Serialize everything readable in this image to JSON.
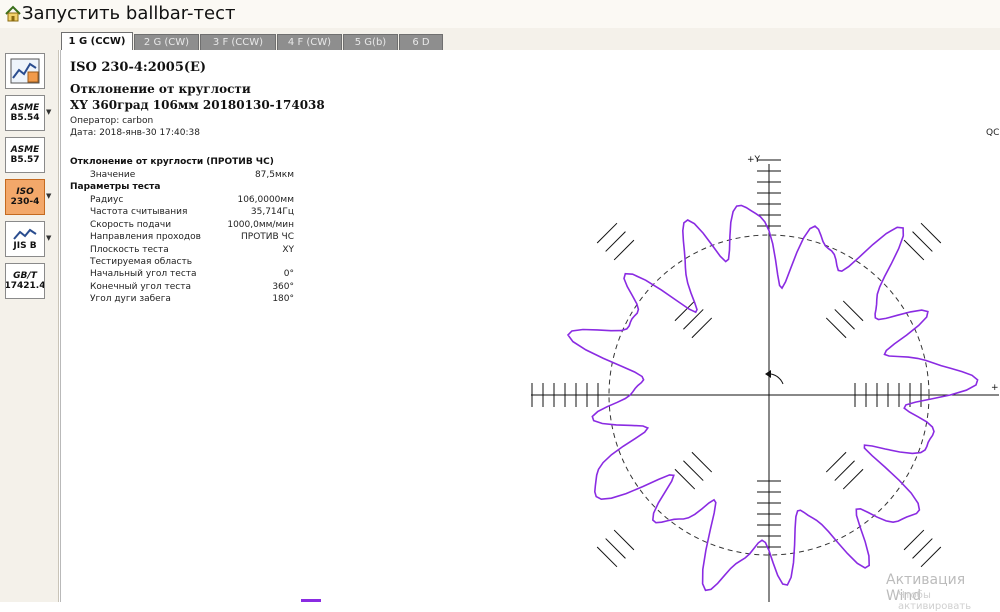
{
  "window": {
    "title": "Запустить ballbar-тест"
  },
  "sidebar": [
    {
      "id": "report",
      "line1": "",
      "line2": ""
    },
    {
      "id": "asme-b554",
      "line1": "ASME",
      "line2": "B5.54"
    },
    {
      "id": "asme-b557",
      "line1": "ASME",
      "line2": "B5.57"
    },
    {
      "id": "iso-2304",
      "line1": "ISO",
      "line2": "230-4"
    },
    {
      "id": "jis-b",
      "line1": "JIS B",
      "line2": ""
    },
    {
      "id": "gbt-174214",
      "line1": "GB/T",
      "line2": "17421.4"
    }
  ],
  "tabs": [
    {
      "label": "1 G (CCW)"
    },
    {
      "label": "2 G (CW)"
    },
    {
      "label": "3 F (CCW)"
    },
    {
      "label": "4 F (CW)"
    },
    {
      "label": "5 G(b)"
    },
    {
      "label": "6 D"
    }
  ],
  "report": {
    "standard": "ISO 230-4:2005(E)",
    "heading": "Отклонение от круглости",
    "subheading": "XY 360град 106мм 20180130-174038",
    "operator": "Оператор: carbon",
    "date": "Дата: 2018-янв-30 17:40:38",
    "right_tag": "QC",
    "section1": "Отклонение от круглости (ПРОТИВ ЧС)",
    "value_label": "Значение",
    "value": "87,5мкм",
    "section2": "Параметры теста",
    "params": [
      {
        "label": "Радиус",
        "value": "106,0000мм"
      },
      {
        "label": "Частота считывания",
        "value": "35,714Гц"
      },
      {
        "label": "Скорость подачи",
        "value": "1000,0мм/мин"
      },
      {
        "label": "Направления проходов",
        "value": "ПРОТИВ ЧС"
      },
      {
        "label": "Плоскость теста",
        "value": "XY"
      },
      {
        "label": "Тестируемая область",
        "value": ""
      },
      {
        "label": "Начальный угол теста",
        "value": "0°"
      },
      {
        "label": "Конечный угол теста",
        "value": "360°"
      },
      {
        "label": "Угол дуги забега",
        "value": "180°"
      }
    ]
  },
  "plot": {
    "axis_y_label": "+Y",
    "axis_x_label": "+",
    "trace_color": "#8a2be2"
  },
  "watermark": {
    "line1": "Активация Wind",
    "line2": "Чтобы активировать"
  }
}
